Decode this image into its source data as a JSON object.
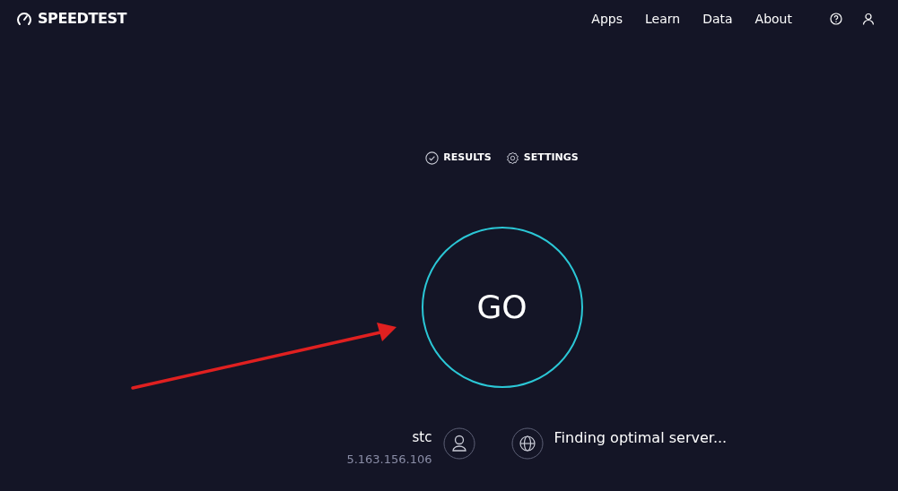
{
  "header": {
    "logo": "SPEEDTEST",
    "nav": [
      "Apps",
      "Learn",
      "Data",
      "About"
    ]
  },
  "tabs": [
    {
      "label": "RESULTS",
      "kind": "results"
    },
    {
      "label": "SETTINGS",
      "kind": "settings"
    }
  ],
  "go_button": "GO",
  "isp": {
    "name": "stc",
    "ip": "5.163.156.106"
  },
  "server": {
    "status": "Finding optimal server..."
  }
}
